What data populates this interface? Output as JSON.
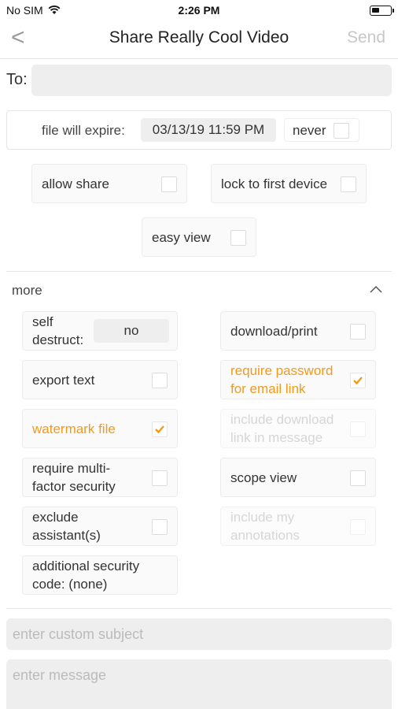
{
  "status": {
    "carrier": "No SIM",
    "time": "2:26 PM"
  },
  "nav": {
    "back": "<",
    "title": "Share Really Cool Video",
    "send": "Send"
  },
  "to": {
    "label": "To:",
    "value": ""
  },
  "expire": {
    "label": "file will expire:",
    "date": "03/13/19 11:59 PM",
    "never": "never"
  },
  "options": {
    "allow_share": "allow share",
    "lock_first_device": "lock to first device",
    "easy_view": "easy view"
  },
  "more": {
    "label": "more",
    "self_destruct_l1": "self",
    "self_destruct_l2": "destruct:",
    "self_destruct_value": "no",
    "download_print": "download/print",
    "export_text": "export text",
    "require_password_l1": "require password",
    "require_password_l2": "for email link",
    "watermark": "watermark file",
    "include_download_l1": "include download",
    "include_download_l2": "link in message",
    "mfa_l1": "require multi-",
    "mfa_l2": "factor security",
    "scope_view": "scope view",
    "exclude_l1": "exclude",
    "exclude_l2": "assistant(s)",
    "annotations_l1": "include my",
    "annotations_l2": "annotations",
    "security_code_l1": "additional security",
    "security_code_l2": "code: (none)"
  },
  "compose": {
    "subject_placeholder": "enter custom subject",
    "message_placeholder": "enter message"
  },
  "colors": {
    "accent": "#f29a1c",
    "field_bg": "#eeeeee"
  }
}
